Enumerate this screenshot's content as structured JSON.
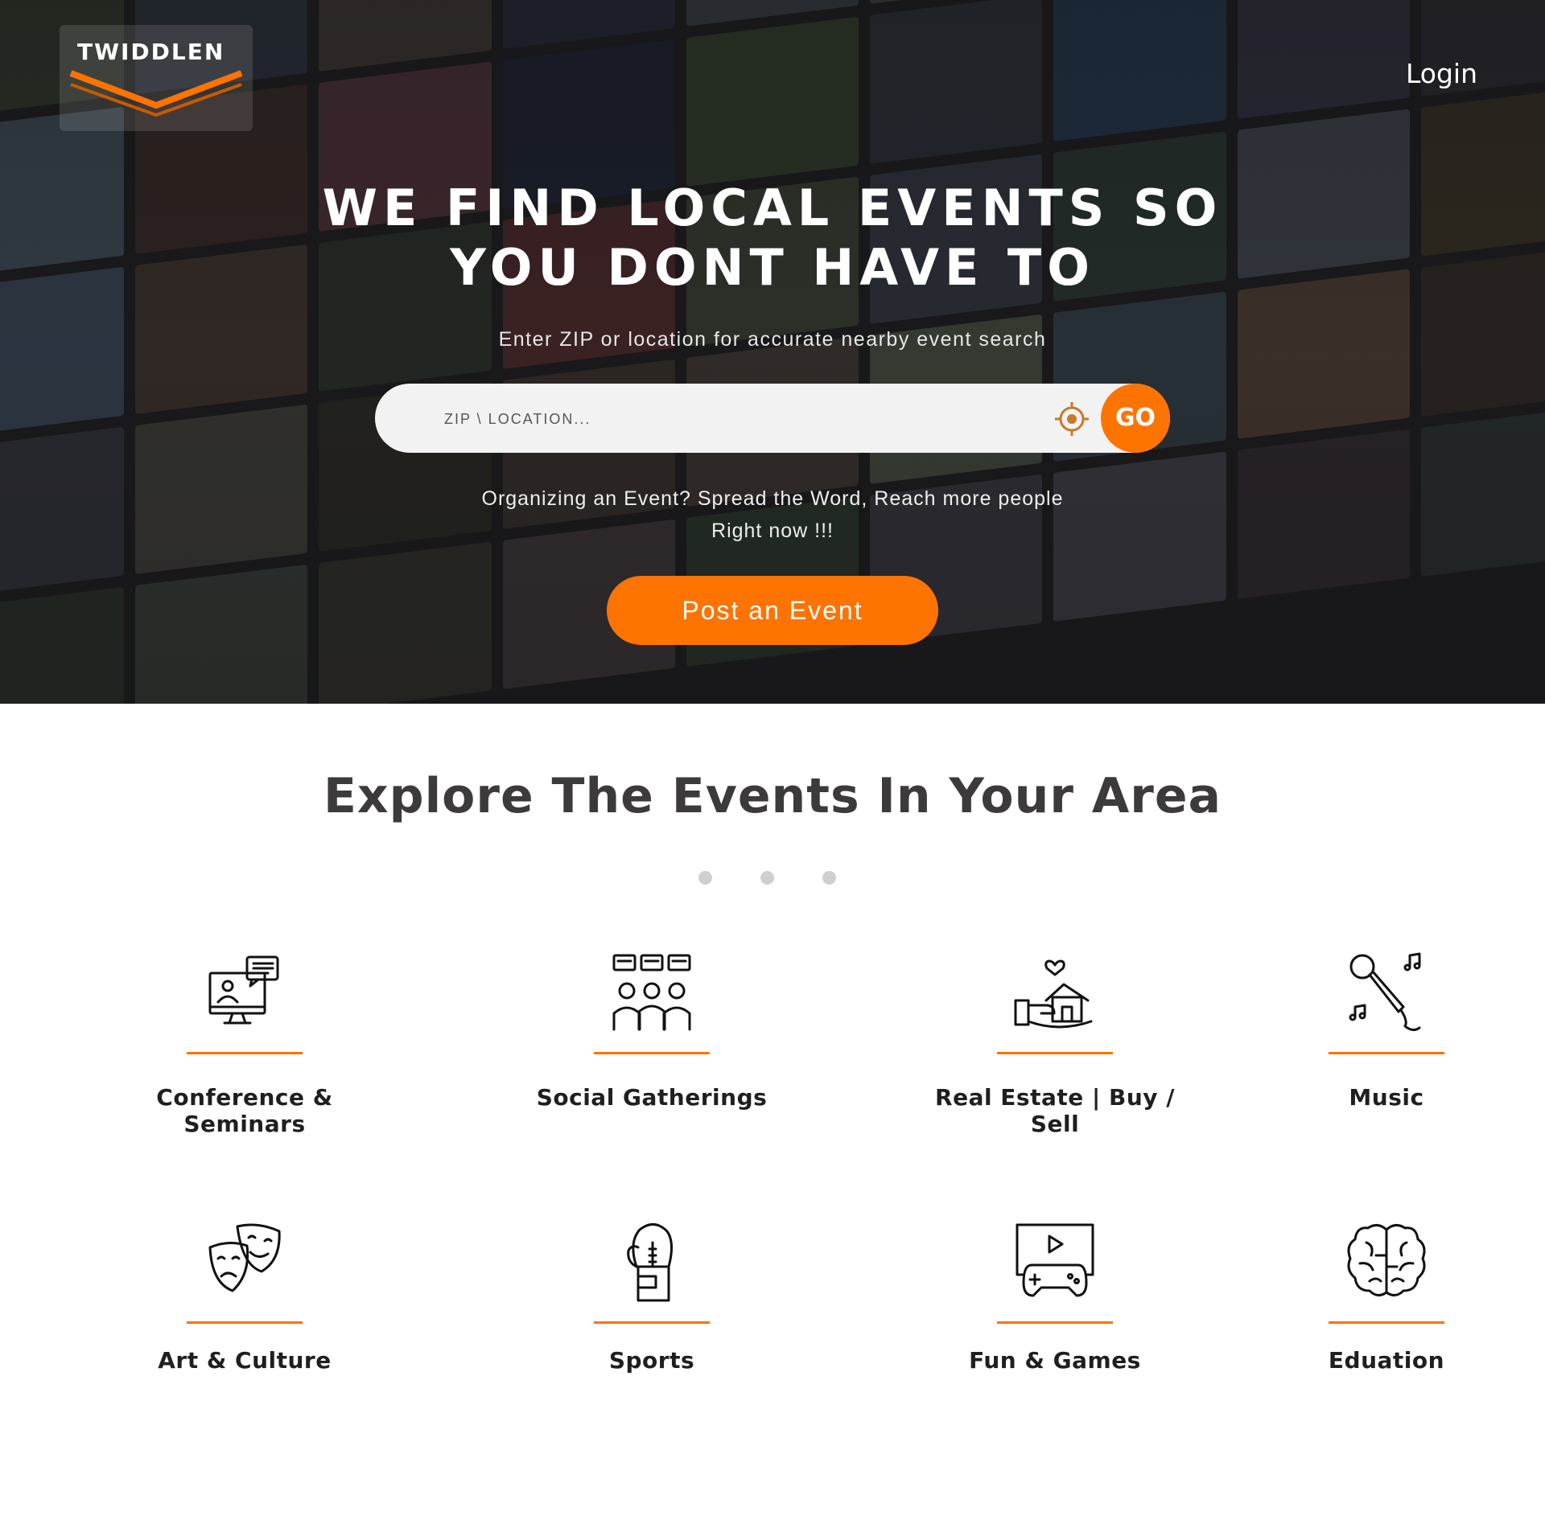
{
  "brand": {
    "logo_text": "TWIDDLEN",
    "accent": "#ff7300"
  },
  "nav": {
    "login_label": "Login"
  },
  "hero": {
    "headline_line1": "WE FIND LOCAL EVENTS SO",
    "headline_line2": "YOU DONT HAVE TO",
    "subline": "Enter ZIP or location for accurate nearby event search",
    "search_placeholder": "ZIP \\ LOCATION...",
    "go_label": "GO",
    "organize_line1": "Organizing an Event?  Spread the Word, Reach more people",
    "organize_line2": "Right now !!!",
    "post_button": "Post an Event"
  },
  "explore": {
    "title": "Explore The Events In Your Area",
    "categories": [
      {
        "label": "Conference & Seminars",
        "icon": "conference-icon"
      },
      {
        "label": "Social Gatherings",
        "icon": "social-gathering-icon"
      },
      {
        "label": "Real Estate | Buy / Sell",
        "icon": "real-estate-icon"
      },
      {
        "label": "Music",
        "icon": "microphone-icon"
      },
      {
        "label": "Art & Culture",
        "icon": "theater-masks-icon"
      },
      {
        "label": "Sports",
        "icon": "boxing-glove-icon"
      },
      {
        "label": "Fun & Games",
        "icon": "gamepad-icon"
      },
      {
        "label": "Eduation",
        "icon": "brain-icon"
      }
    ]
  }
}
